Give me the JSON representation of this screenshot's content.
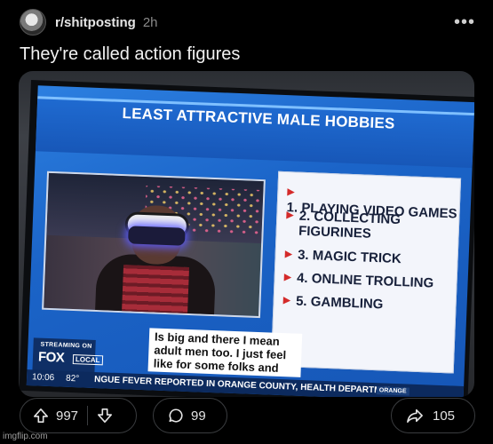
{
  "post": {
    "subreddit": "r/shitposting",
    "age": "2h",
    "title": "They're called action figures"
  },
  "tv": {
    "banner_title": "LEAST ATTRACTIVE MALE HOBBIES",
    "list": [
      {
        "lines": [
          "1. PLAYING VIDEO GAMES"
        ]
      },
      {
        "lines": [
          "2. COLLECTING",
          "FIGURINES"
        ]
      },
      {
        "lines": [
          "3. MAGIC TRICK"
        ]
      },
      {
        "lines": [
          "4. ONLINE TROLLING"
        ]
      },
      {
        "lines": [
          "5. GAMBLING"
        ]
      }
    ],
    "caption": "Is big and there I mean adult men too. I just feel like for some folks and",
    "logo_top": "STREAMING ON",
    "logo_fox": "FOX",
    "logo_local": "LOCAL",
    "time": "10:06",
    "temp": "82°",
    "ticker": "NGUE FEVER REPORTED IN ORANGE COUNTY, HEALTH DEPARTMENT S",
    "ticker_tag": "ORANGE"
  },
  "actions": {
    "upvotes": "997",
    "comments": "99",
    "shares": "105"
  },
  "watermark": "imgflip.com"
}
